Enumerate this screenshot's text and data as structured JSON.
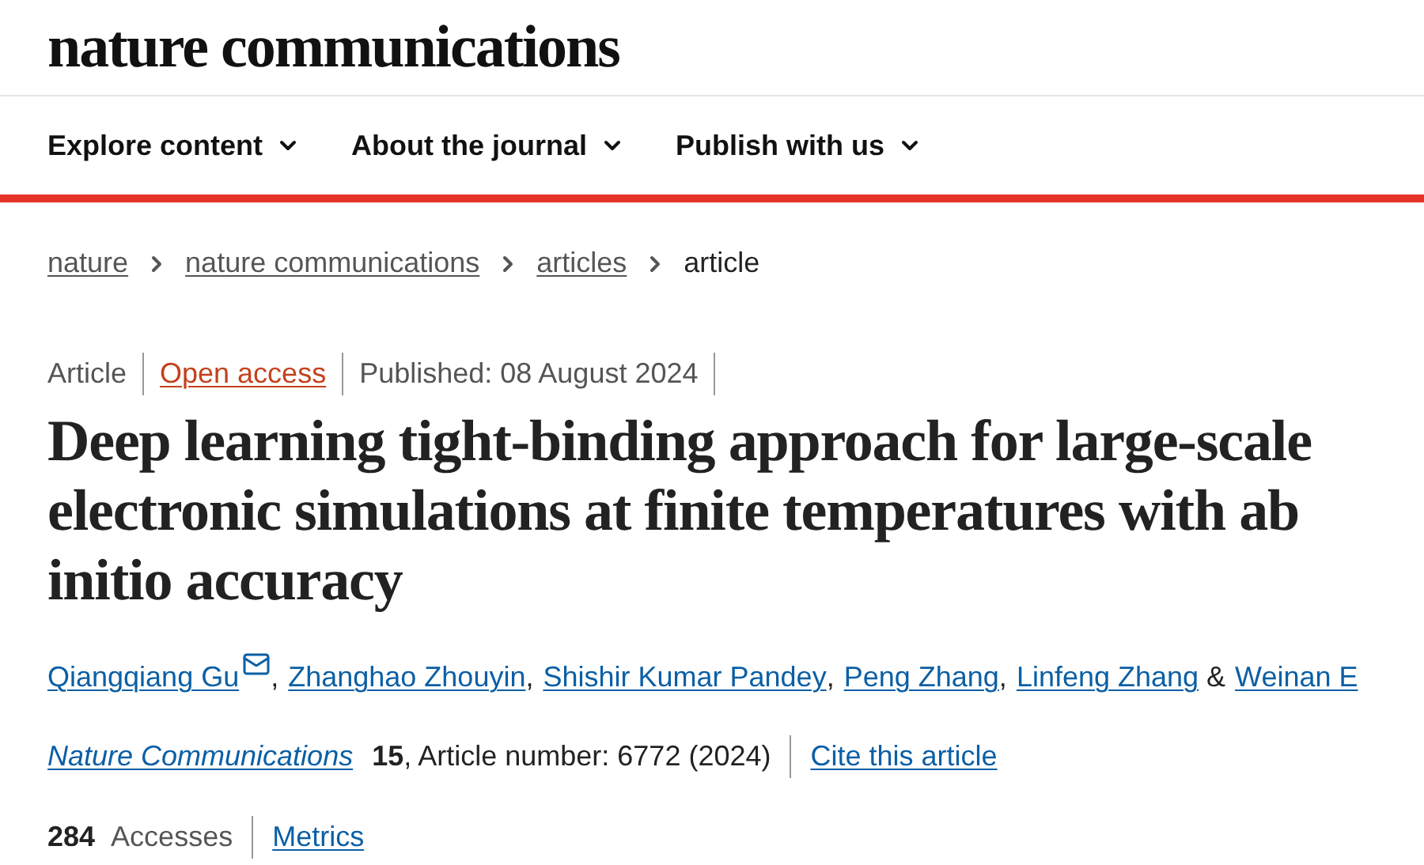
{
  "logo": "nature communications",
  "nav": [
    {
      "label": "Explore content"
    },
    {
      "label": "About the journal"
    },
    {
      "label": "Publish with us"
    }
  ],
  "breadcrumbs": [
    {
      "label": "nature",
      "link": true
    },
    {
      "label": "nature communications",
      "link": true
    },
    {
      "label": "articles",
      "link": true
    },
    {
      "label": "article",
      "link": false
    }
  ],
  "meta": {
    "type": "Article",
    "access": "Open access",
    "published": "Published: 08 August 2024"
  },
  "title": "Deep learning tight-binding approach for large-scale electronic simulations at finite temperatures with ab initio accuracy",
  "authors": [
    {
      "name": "Qiangqiang Gu",
      "email": true,
      "suffix": ","
    },
    {
      "name": "Zhanghao Zhouyin",
      "email": false,
      "suffix": ","
    },
    {
      "name": "Shishir Kumar Pandey",
      "email": false,
      "suffix": ","
    },
    {
      "name": "Peng Zhang",
      "email": false,
      "suffix": ","
    },
    {
      "name": "Linfeng Zhang",
      "email": false,
      "suffix": " &"
    },
    {
      "name": "Weinan E",
      "email": false
    }
  ],
  "citation": {
    "journal": "Nature Communications",
    "volume": "15",
    "details": ", Article number: 6772 (2024)",
    "cite": "Cite this article"
  },
  "metrics": {
    "count": "284",
    "label": "Accesses",
    "link": "Metrics"
  }
}
